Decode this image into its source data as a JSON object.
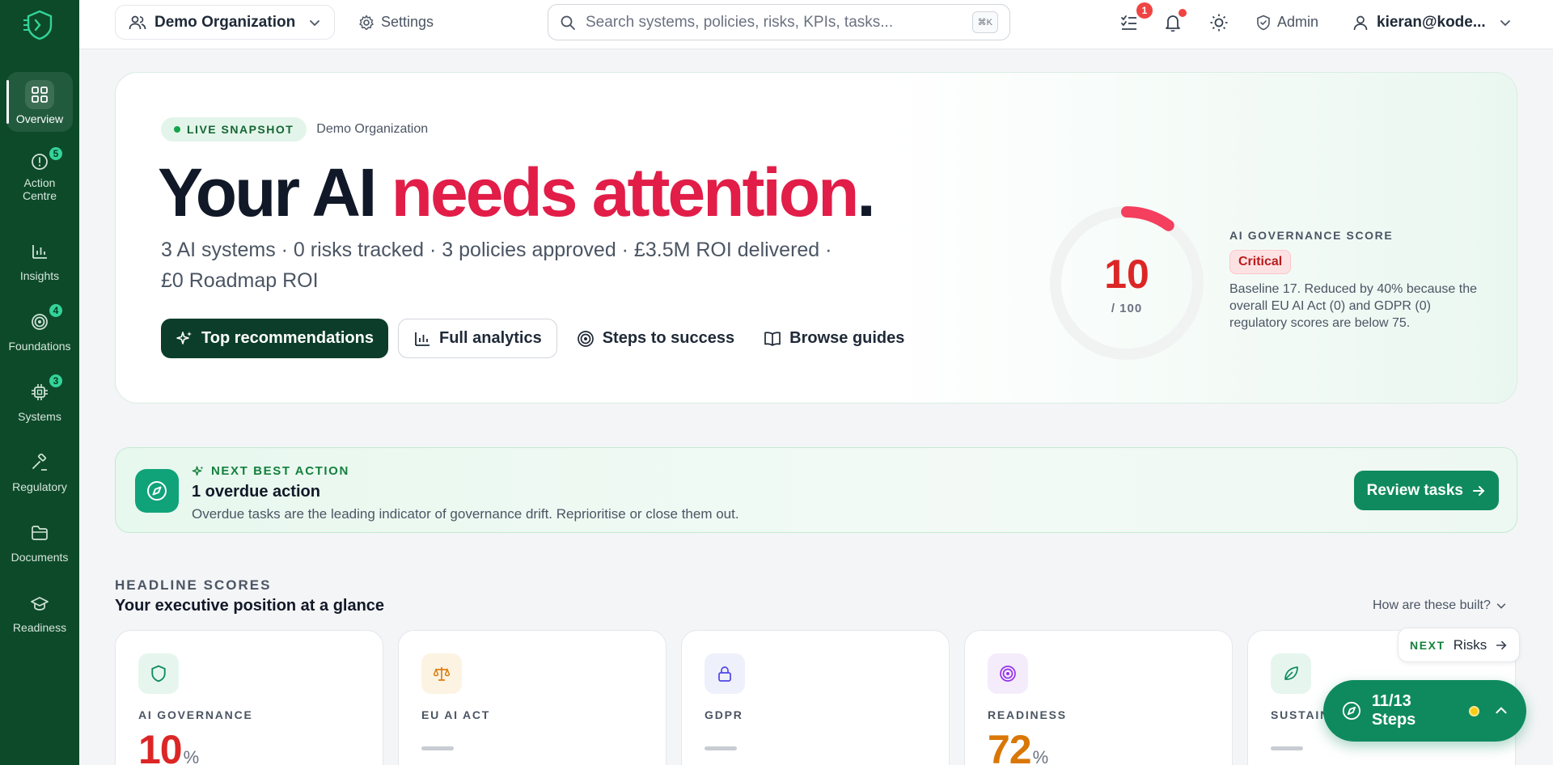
{
  "sidebar": {
    "items": [
      {
        "label": "Overview",
        "icon": "grid-icon",
        "badge": ""
      },
      {
        "label": "Action Centre",
        "icon": "alert-circle-icon",
        "badge": "5"
      },
      {
        "label": "Insights",
        "icon": "bar-chart-icon",
        "badge": ""
      },
      {
        "label": "Foundations",
        "icon": "target-icon",
        "badge": "4"
      },
      {
        "label": "Systems",
        "icon": "cpu-icon",
        "badge": "3"
      },
      {
        "label": "Regulatory",
        "icon": "gavel-icon",
        "badge": ""
      },
      {
        "label": "Documents",
        "icon": "folder-icon",
        "badge": ""
      },
      {
        "label": "Readiness",
        "icon": "graduation-cap-icon",
        "badge": ""
      }
    ]
  },
  "topbar": {
    "org_name": "Demo Organization",
    "settings_label": "Settings",
    "search_placeholder": "Search systems, policies, risks, KPIs, tasks...",
    "search_shortcut": "⌘K",
    "tasks_badge": "1",
    "admin_label": "Admin",
    "user_email": "kieran@kode..."
  },
  "hero": {
    "snapshot_label": "LIVE SNAPSHOT",
    "org_name": "Demo Organization",
    "headline_prefix": "Your AI ",
    "headline_emphasis": "needs attention",
    "headline_suffix": ".",
    "summary": "3 AI systems · 0 risks tracked · 3 policies approved · £3.5M ROI delivered · £0 Roadmap ROI",
    "actions": {
      "top_recommendations": "Top recommendations",
      "full_analytics": "Full analytics",
      "steps_to_success": "Steps to success",
      "browse_guides": "Browse guides"
    },
    "score": {
      "value": "10",
      "max": "/ 100",
      "fraction": 0.1,
      "title": "AI GOVERNANCE SCORE",
      "status": "Critical",
      "description": "Baseline 17. Reduced by 40% because the overall EU AI Act (0) and GDPR (0) regulatory scores are below 75."
    }
  },
  "next_best_action": {
    "label": "NEXT BEST ACTION",
    "title": "1 overdue action",
    "description": "Overdue tasks are the leading indicator of governance drift. Reprioritise or close them out.",
    "button": "Review tasks"
  },
  "headline_scores": {
    "label": "HEADLINE SCORES",
    "title": "Your executive position at a glance",
    "how_link": "How are these built?",
    "cards": [
      {
        "label": "AI GOVERNANCE",
        "value": "10",
        "unit": "%",
        "color": "#dc2626",
        "icon": "shield-icon"
      },
      {
        "label": "EU AI ACT",
        "value": "",
        "unit": "",
        "color": "#9ca3af",
        "icon": "scale-icon"
      },
      {
        "label": "GDPR",
        "value": "",
        "unit": "",
        "color": "#9ca3af",
        "icon": "lock-icon"
      },
      {
        "label": "READINESS",
        "value": "72",
        "unit": "%",
        "color": "#d97706",
        "icon": "target-icon"
      },
      {
        "label": "SUSTAIN",
        "value": "",
        "unit": "",
        "color": "#9ca3af",
        "icon": "leaf-icon"
      }
    ]
  },
  "floating": {
    "next_label": "NEXT",
    "next_target": "Risks",
    "steps_label": "11/13 Steps"
  },
  "colors": {
    "sidebar": "#0d4a2a",
    "accent": "#0f8a5f",
    "critical": "#dc2626",
    "warning": "#d97706"
  }
}
